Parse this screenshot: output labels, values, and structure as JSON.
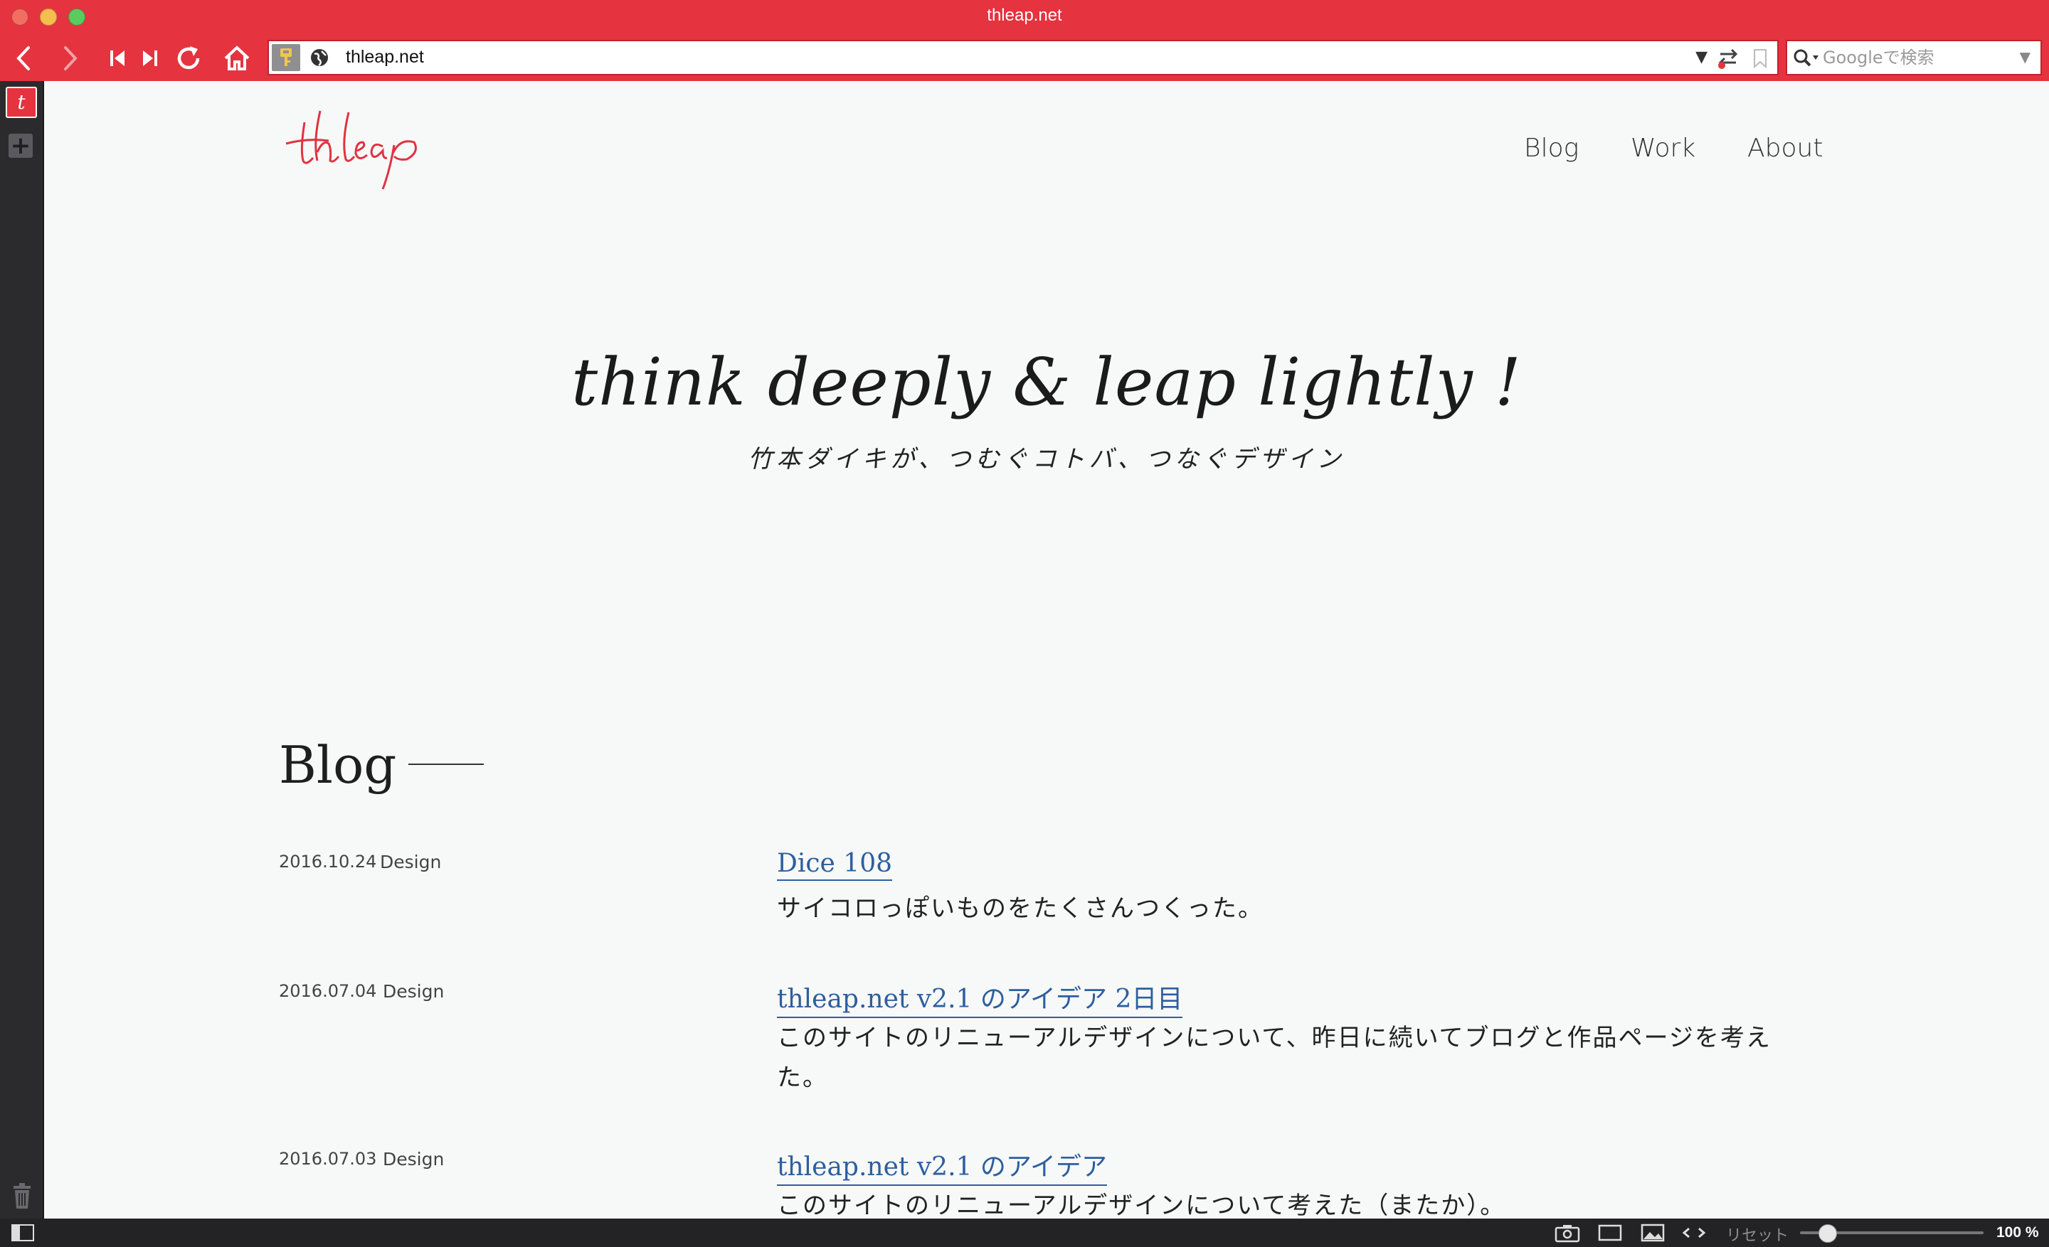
{
  "window": {
    "title": "thleap.net"
  },
  "toolbar": {
    "back_icon": "chevron-left-icon",
    "forward_icon": "chevron-right-icon",
    "url": "thleap.net",
    "search_placeholder": "Googleで検索"
  },
  "statusbar": {
    "reset_label": "リセット",
    "zoom": "100 %",
    "zoom_level": 0.15
  },
  "site": {
    "logo_text": "thleap",
    "nav": [
      "Blog",
      "Work",
      "About"
    ],
    "tagline": "think deeply & leap lightly !",
    "subtagline": "竹本ダイキが、つむぐコトバ、つなぐデザイン"
  },
  "blog": {
    "heading": "Blog",
    "posts": [
      {
        "date": "2016.10.24",
        "category": "Design",
        "title": "Dice 108",
        "excerpt": "サイコロっぽいものをたくさんつくった。"
      },
      {
        "date": "2016.07.04",
        "category": "Design",
        "title": "thleap.net v2.1 のアイデア 2日目",
        "excerpt": "このサイトのリニューアルデザインについて、昨日に続いてブログと作品ページを考えた。"
      },
      {
        "date": "2016.07.03",
        "category": "Design",
        "title": "thleap.net v2.1 のアイデア",
        "excerpt": "このサイトのリニューアルデザインについて考えた（またか）。"
      }
    ]
  },
  "colors": {
    "chrome_red": "#e5333f",
    "link_blue": "#2d5f9e",
    "logo_red": "#e03340"
  }
}
